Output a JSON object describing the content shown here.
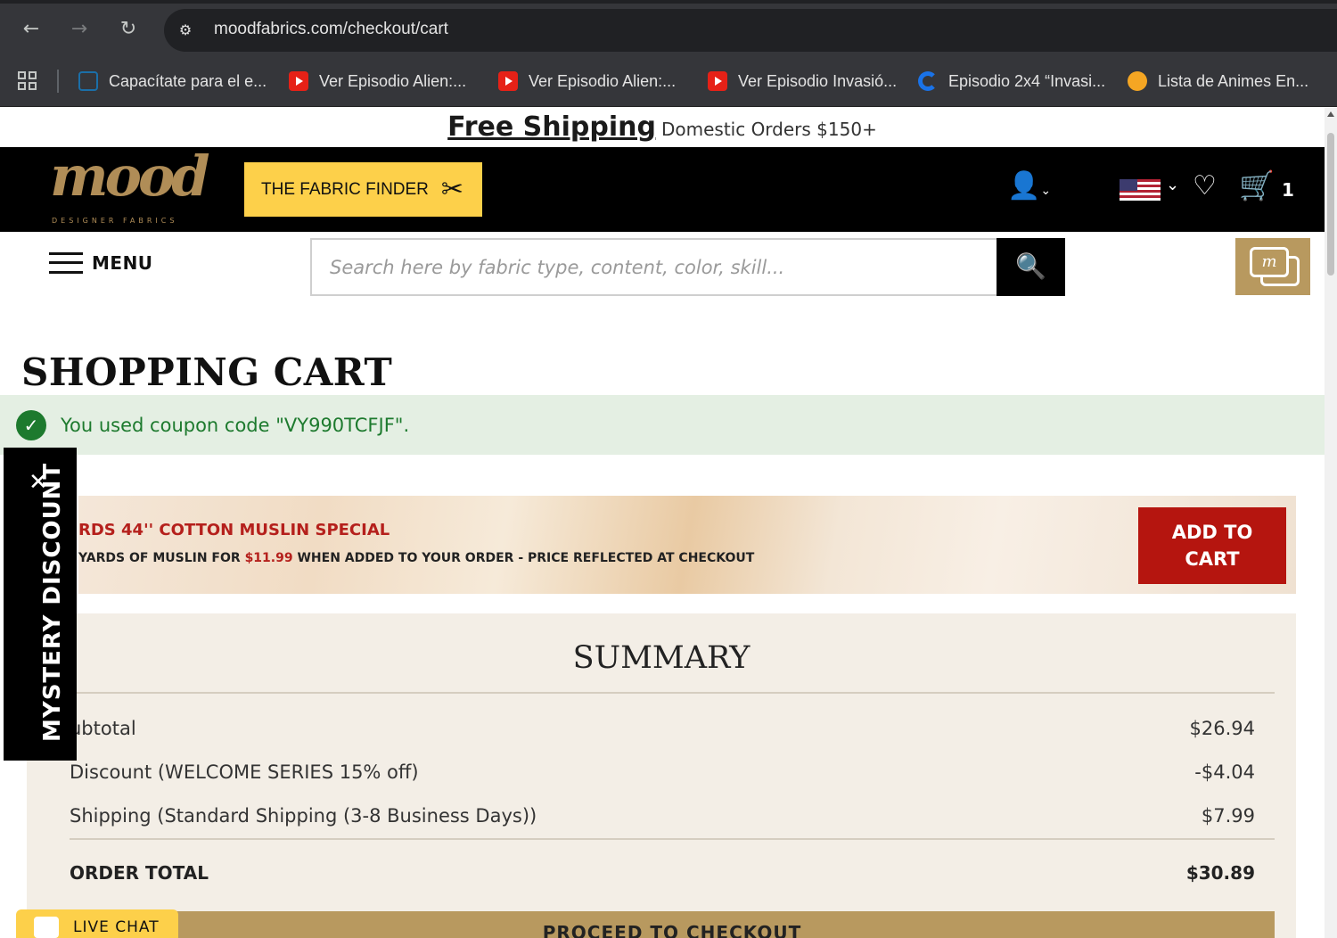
{
  "browser": {
    "url": "moodfabrics.com/checkout/cart",
    "bookmarks": [
      {
        "label": "Capacítate para el e...",
        "icon": "document-icon"
      },
      {
        "label": "Ver Episodio Alien:...",
        "icon": "youtube-icon"
      },
      {
        "label": "Ver Episodio Alien:...",
        "icon": "youtube-icon"
      },
      {
        "label": "Ver Episodio Invasió...",
        "icon": "youtube-icon"
      },
      {
        "label": "Episodio 2x4 “Invasi...",
        "icon": "edge-icon"
      },
      {
        "label": "Lista de Animes En...",
        "icon": "ball-icon"
      }
    ]
  },
  "promo": {
    "strong": "Free Shipping",
    "light": "Domestic Orders $150+"
  },
  "header": {
    "logo_text": "mood",
    "logo_sub": "DESIGNER FABRICS",
    "fabric_finder": "THE FABRIC FINDER",
    "cart_count": "1"
  },
  "nav": {
    "menu_label": "MENU",
    "search_placeholder": "Search here by fabric type, content, color, skill..."
  },
  "cart": {
    "title": "SHOPPING CART",
    "coupon_message": "You used coupon code \"VY990TCFJF\"."
  },
  "muslin_offer": {
    "title": "RDS 44'' COTTON MUSLIN SPECIAL",
    "sub_before": "YARDS OF MUSLIN FOR ",
    "price": "$11.99",
    "sub_after": " WHEN ADDED TO YOUR ORDER - PRICE REFLECTED AT CHECKOUT",
    "button": "ADD TO CART"
  },
  "summary": {
    "title": "SUMMARY",
    "rows": [
      {
        "label": "ubtotal",
        "value": "$26.94"
      },
      {
        "label": "Discount (WELCOME SERIES 15% off)",
        "value": "-$4.04"
      },
      {
        "label": "Shipping (Standard Shipping (3-8 Business Days))",
        "value": "$7.99"
      }
    ],
    "total_label": "ORDER TOTAL",
    "total_value": "$30.89",
    "checkout_button": "PROCEED TO CHECKOUT"
  },
  "widgets": {
    "mystery_discount": "MYSTERY DISCOUNT",
    "live_chat": "LIVE CHAT"
  },
  "colors": {
    "brand_gold": "#b8995f",
    "finder_yellow": "#fdd04a",
    "offer_red": "#b5150f",
    "success_green": "#1d7a2e"
  }
}
